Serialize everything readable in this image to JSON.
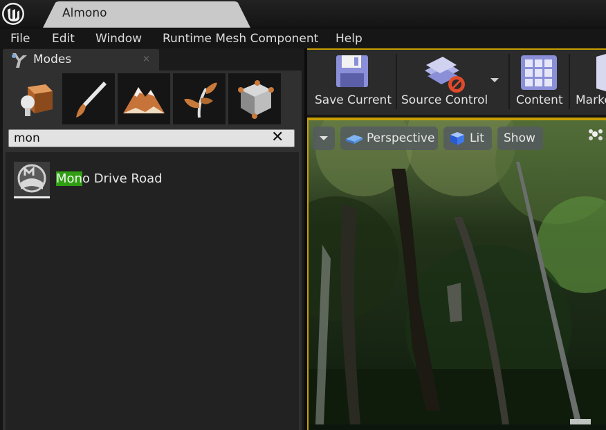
{
  "window": {
    "doc_tab": "Almono"
  },
  "menu": [
    "File",
    "Edit",
    "Window",
    "Runtime Mesh Component",
    "Help"
  ],
  "modes_panel": {
    "tab_label": "Modes",
    "close_glyph": "×",
    "mode_tabs": [
      "place-mode-icon",
      "paint-mode-icon",
      "landscape-mode-icon",
      "foliage-mode-icon",
      "geometry-edit-mode-icon"
    ],
    "search": {
      "value": "mon",
      "clear_glyph": "✕"
    },
    "results": [
      {
        "match": "Mon",
        "rest": "o Drive Road",
        "icon": "road-actor-icon"
      }
    ]
  },
  "toolbar": {
    "save_current": "Save Current",
    "source_control": "Source Control",
    "content": "Content",
    "marketplace_partial": "Marke"
  },
  "viewport": {
    "perspective": "Perspective",
    "lit": "Lit",
    "show": "Show"
  },
  "colors": {
    "accent_gold": "#c8a000",
    "search_highlight": "#2f9e12"
  }
}
